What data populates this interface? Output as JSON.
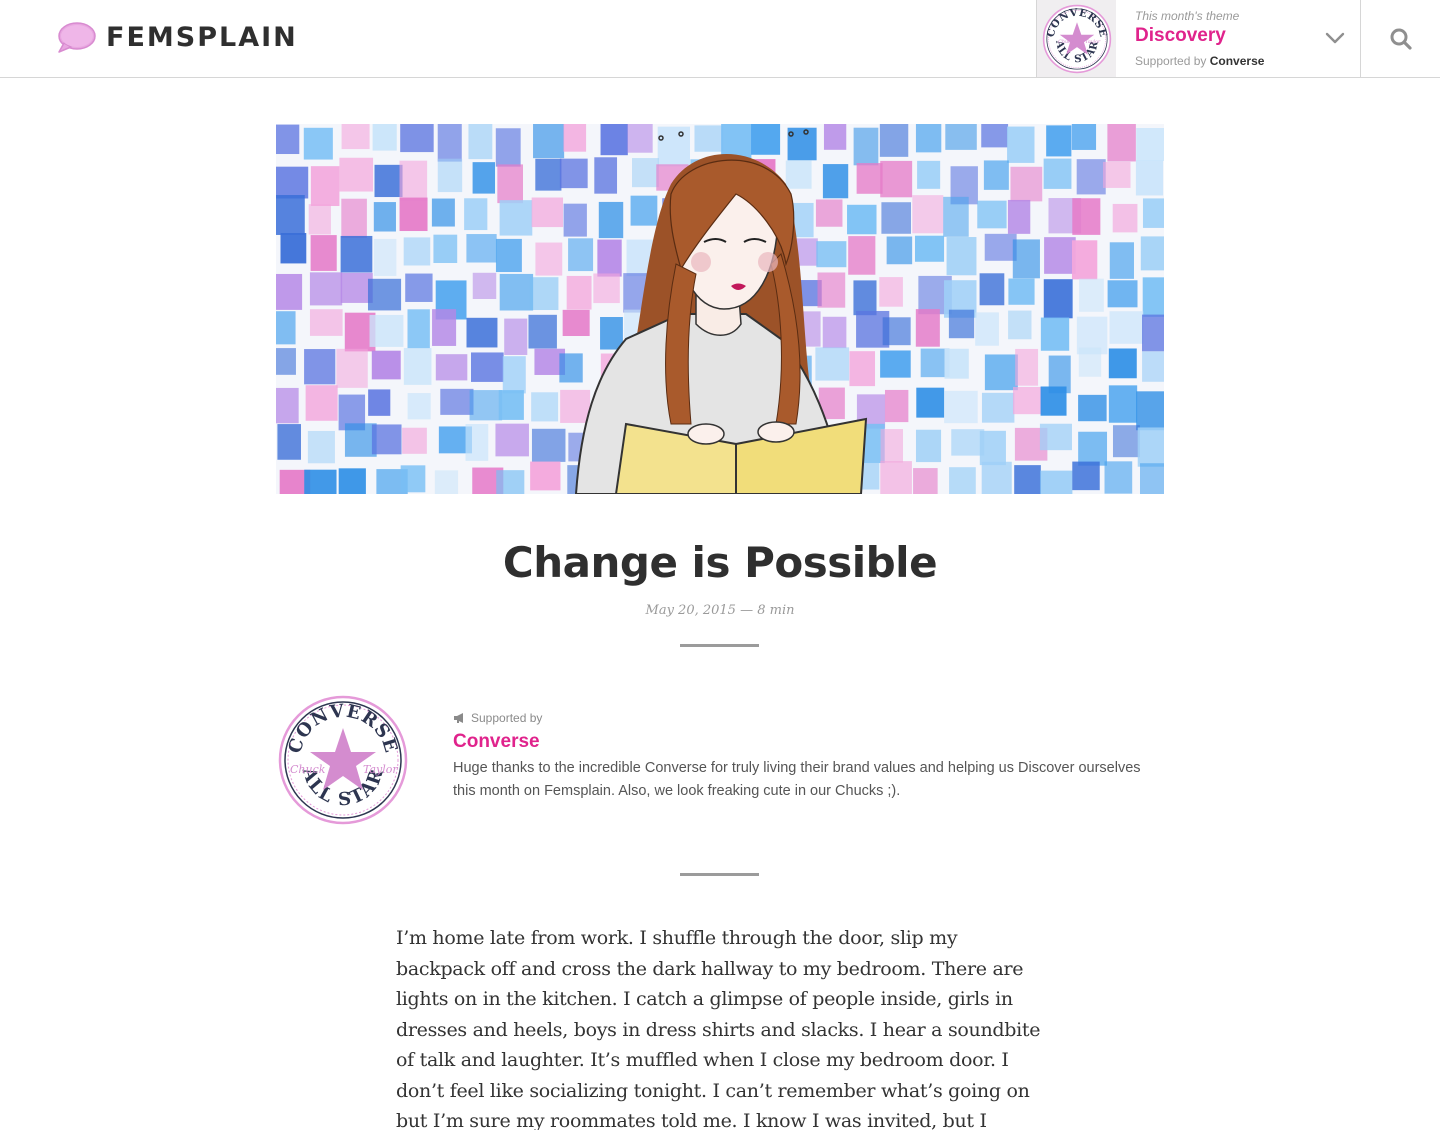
{
  "header": {
    "logo_text": "FEMSPLAIN",
    "theme_kicker": "This month's theme",
    "theme_name": "Discovery",
    "theme_support_prefix": "Supported by",
    "theme_support_brand": "Converse",
    "theme_logo_text": {
      "top": "CONVERSE",
      "mid_left": "Chuck",
      "mid_right": "Taylor",
      "bottom": "ALL STAR"
    }
  },
  "article": {
    "title": "Change is Possible",
    "meta": "May 20, 2015 — 8 min",
    "body": "I’m home late from work. I shuffle through the door, slip my backpack off and cross the dark hallway to my bedroom. There are lights on in the kitchen. I catch a glimpse of people inside, girls in dresses and heels, boys in dress shirts and slacks. I hear a soundbite of talk and laughter. It’s muffled when I close my bedroom door. I don’t feel like socializing tonight. I can’t remember what’s going on but I’m sure my roommates told me. I know I was invited, but I turned it down. I’m exhausted. I"
  },
  "sponsor": {
    "kicker": "Supported by",
    "name": "Converse",
    "description": "Huge thanks to the incredible Converse for truly living their brand values and helping us Discover ourselves this month on Femsplain. Also, we look freaking cute in our Chucks ;).",
    "logo_text": {
      "top": "CONVERSE",
      "mid_left": "Chuck",
      "mid_right": "Taylor",
      "bottom": "ALL STAR"
    }
  },
  "colors": {
    "accent": "#e0238c",
    "logo_pink": "#e8a6e0",
    "star_pink": "#d48ccf",
    "text": "#333333",
    "muted": "#9a9a9a"
  },
  "icons": {
    "logo": "speech-bubble-icon",
    "chevron": "chevron-down-icon",
    "search": "search-icon",
    "megaphone": "megaphone-icon"
  }
}
